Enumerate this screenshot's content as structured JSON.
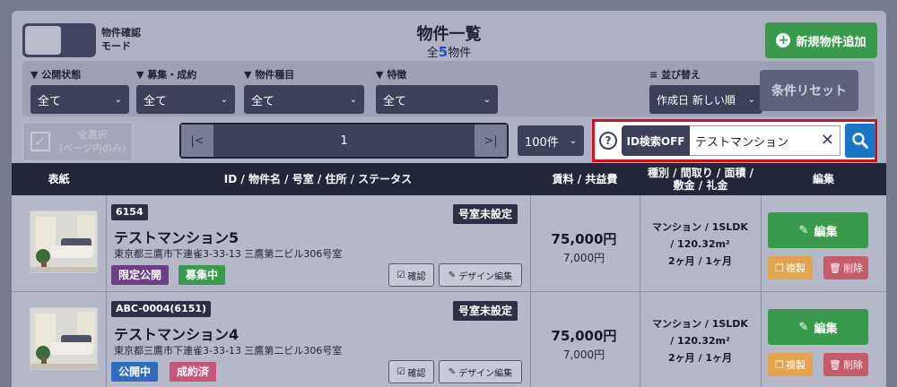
{
  "header": {
    "toggle_label_line1": "物件確認",
    "toggle_label_line2": "モード",
    "title": "物件一覧",
    "count_prefix": "全",
    "count_value": "5",
    "count_suffix": "物件",
    "add_button": "新規物件追加"
  },
  "filters": [
    {
      "label": "公開状態",
      "value": "全て"
    },
    {
      "label": "募集・成約",
      "value": "全て"
    },
    {
      "label": "物件種目",
      "value": "全て"
    },
    {
      "label": "特徴",
      "value": "全て"
    }
  ],
  "sort": {
    "label": "並び替え",
    "value": "作成日 新しい順"
  },
  "reset_button": "条件リセット",
  "select_all": {
    "line1": "全選択",
    "line2": "(ページ内のみ)"
  },
  "pager": {
    "first": "|<",
    "page": "1",
    "last": ">|"
  },
  "per_page": "100件",
  "id_search": {
    "help": "?",
    "toggle": "ID検索OFF",
    "value": "テストマンション",
    "clear": "✕"
  },
  "table": {
    "headers": [
      "表紙",
      "ID / 物件名 / 号室 / 住所 / ステータス",
      "賃料 / 共益費",
      "種別 / 間取り / 面積 / 敷金 / 礼金",
      "編集"
    ],
    "rows": [
      {
        "id": "6154",
        "room_tag": "号室未設定",
        "name": "テストマンション5",
        "address": "東京都三鷹市下連雀3-33-13 三鷹第二ビル306号室",
        "badge1": "限定公開",
        "badge2": "募集中",
        "confirm": "確認",
        "design_edit": "デザイン編集",
        "rent": "75,000円",
        "fee": "7,000円",
        "spec1": "マンション / 1SLDK",
        "spec2": "/ 120.32m²",
        "spec3": "2ヶ月 / 1ヶ月",
        "edit": "編集",
        "copy": "複製",
        "delete": "削除"
      },
      {
        "id": "ABC-0004(6151)",
        "room_tag": "号室未設定",
        "name": "テストマンション4",
        "address": "東京都三鷹市下連雀3-33-13 三鷹第二ビル306号室",
        "badge1": "公開中",
        "badge2": "成約済",
        "confirm": "確認",
        "design_edit": "デザイン編集",
        "rent": "75,000円",
        "fee": "7,000円",
        "spec1": "マンション / 1SLDK",
        "spec2": "/ 120.32m²",
        "spec3": "2ヶ月 / 1ヶ月",
        "edit": "編集",
        "copy": "複製",
        "delete": "削除"
      }
    ]
  },
  "colors": {
    "overlay": "#777b8e",
    "accent_green": "#3a9a4c",
    "search_blue": "#1976c7",
    "highlight_red": "#d4101e"
  }
}
